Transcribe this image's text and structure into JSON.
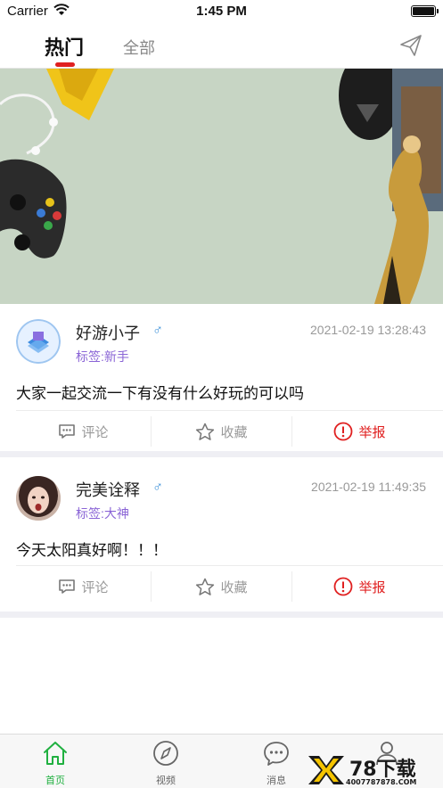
{
  "status_bar": {
    "carrier": "Carrier",
    "time": "1:45 PM"
  },
  "top_tabs": [
    {
      "label": "热门",
      "active": true
    },
    {
      "label": "全部",
      "active": false
    }
  ],
  "colors": {
    "accent": "#20b040",
    "indicator": "#e02020",
    "tag": "#8a64d6",
    "male": "#3a8fd8"
  },
  "posts": [
    {
      "username": "好游小子",
      "gender_icon": "male-icon",
      "tag": "标签:新手",
      "time": "2021-02-19 13:28:43",
      "content": "大家一起交流一下有没有什么好玩的可以吗",
      "actions": {
        "comment": "评论",
        "favorite": "收藏",
        "report": "举报"
      }
    },
    {
      "username": "完美诠释",
      "gender_icon": "male-icon",
      "tag": "标签:大神",
      "time": "2021-02-19 11:49:35",
      "content": "今天太阳真好啊！！！",
      "actions": {
        "comment": "评论",
        "favorite": "收藏",
        "report": "举报"
      }
    }
  ],
  "tabbar": [
    {
      "label": "首页",
      "icon": "home-icon",
      "active": true
    },
    {
      "label": "视频",
      "icon": "compass-icon",
      "active": false
    },
    {
      "label": "消息",
      "icon": "message-icon",
      "active": false
    },
    {
      "label": "",
      "icon": "person-icon",
      "active": false
    }
  ],
  "watermark": {
    "text": "78下载",
    "sub": "4007787878.COM"
  }
}
